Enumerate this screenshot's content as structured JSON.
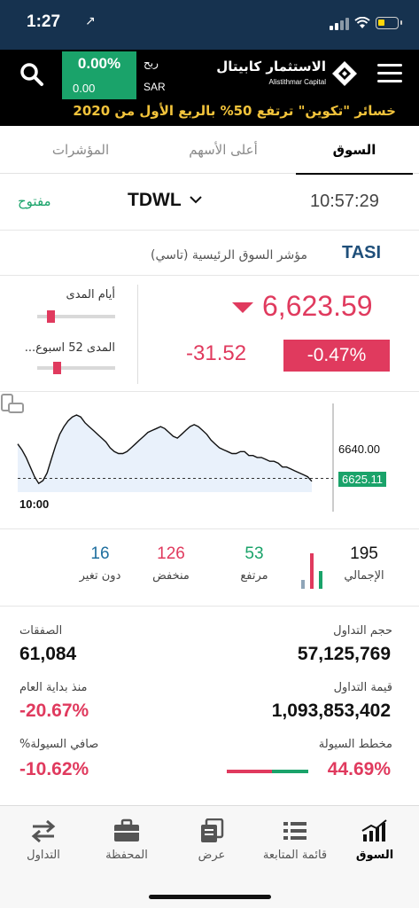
{
  "status_bar": {
    "time": "1:27",
    "location_glyph": "↗",
    "wifi_icon": "wifi-icon",
    "battery_icon": "battery-icon"
  },
  "header": {
    "quote": {
      "percent": "0.00%",
      "value": "0.00",
      "label_profit": "ربح",
      "currency": "SAR"
    },
    "brand": {
      "name_ar": "الاستثمار كابيتال",
      "name_en": "Alistithmar Capital"
    },
    "ticker_text": "خسائر \"تكوين\" ترتفع 50% بالربع الأول من 2020"
  },
  "tabs": [
    {
      "label": "السوق",
      "active": true
    },
    {
      "label": "أعلى الأسهم",
      "active": false
    },
    {
      "label": "المؤشرات",
      "active": false
    }
  ],
  "market": {
    "time": "10:57:29",
    "name": "TDWL",
    "status": "مفتوح",
    "status_color": "#1aa36a"
  },
  "index": {
    "code": "TASI",
    "name": "مؤشر السوق الرئيسية (تاسي)",
    "price": "6,623.59",
    "change": "-31.52",
    "change_pct": "-0.47%",
    "range_day_label": "أيام المدى",
    "range_day_position": 0.12,
    "range_52w_label": "المدى 52 اسبوع...",
    "range_52w_position": 0.2,
    "down_color": "#e03a5e",
    "up_color": "#1aa36a"
  },
  "chart_data": {
    "type": "line",
    "x_start_label": "10:00",
    "y_labels": [
      "6640.00",
      "6625.11"
    ],
    "reference_value": 6625.11,
    "last_value": 6623.59,
    "x": [
      0,
      1,
      2,
      3,
      4,
      5,
      6,
      7,
      8,
      9,
      10,
      11,
      12,
      13,
      14,
      15,
      16,
      17,
      18,
      19,
      20,
      21,
      22,
      23,
      24,
      25,
      26,
      27,
      28,
      29,
      30,
      31,
      32,
      33,
      34,
      35,
      36,
      37,
      38,
      39,
      40,
      41,
      42,
      43,
      44,
      45,
      46,
      47,
      48,
      49,
      50,
      51,
      52,
      53,
      54,
      55,
      56,
      57,
      58,
      59,
      60,
      61,
      62,
      63,
      64,
      65,
      66,
      67,
      68,
      69,
      70
    ],
    "y": [
      6643,
      6640,
      6636,
      6631,
      6626,
      6622.5,
      6624,
      6628,
      6635,
      6642,
      6648,
      6652,
      6655,
      6657,
      6658,
      6657,
      6654,
      6652,
      6650,
      6648,
      6646,
      6644,
      6641,
      6639,
      6638,
      6638,
      6639,
      6641,
      6643,
      6645,
      6647,
      6649,
      6650,
      6651,
      6652,
      6651,
      6649,
      6647,
      6646,
      6648,
      6650,
      6652,
      6653,
      6652,
      6650,
      6648,
      6645,
      6643,
      6641,
      6640,
      6639,
      6638,
      6638,
      6639,
      6639,
      6637,
      6637,
      6636,
      6636,
      6635,
      6634,
      6634,
      6633,
      6631,
      6631,
      6630,
      6629,
      6628,
      6627,
      6626,
      6623.6
    ],
    "ylim": [
      6618,
      6664
    ],
    "series_color": "#111111",
    "fill_color": "#e9f1fb",
    "reference_color": "#333333"
  },
  "breadth": {
    "total": {
      "value": "195",
      "label": "الإجمالي"
    },
    "up": {
      "value": "53",
      "label": "مرتفع",
      "color": "#1aa36a"
    },
    "down": {
      "value": "126",
      "label": "منخفض",
      "color": "#e03a5e"
    },
    "unchanged": {
      "value": "16",
      "label": "دون تغير",
      "color": "#1f6f9f"
    },
    "bar_colors": [
      "#e03a5e",
      "#1aa36a",
      "#8fa5b8"
    ]
  },
  "stats": {
    "volume": {
      "label": "حجم التداول",
      "value": "57,125,769"
    },
    "trades": {
      "label": "الصفقات",
      "value": "61,084"
    },
    "turnover": {
      "label": "قيمة التداول",
      "value": "1,093,853,402"
    },
    "ytd": {
      "label": "منذ بداية العام",
      "value": "-20.67%"
    },
    "liquidity": {
      "label": "مخطط السيولة",
      "value": "44.69%",
      "positive_share": 0.4469
    },
    "net_liquidity": {
      "label": "صافي السيولة%",
      "value": "-10.62%"
    }
  },
  "bottom_nav": [
    {
      "label": "السوق",
      "icon": "market-chart-icon",
      "active": true
    },
    {
      "label": "قائمة المتابعة",
      "icon": "watchlist-icon",
      "active": false
    },
    {
      "label": "عرض",
      "icon": "quotes-icon",
      "active": false
    },
    {
      "label": "المحفظة",
      "icon": "briefcase-icon",
      "active": false
    },
    {
      "label": "التداول",
      "icon": "trade-arrows-icon",
      "active": false
    }
  ]
}
